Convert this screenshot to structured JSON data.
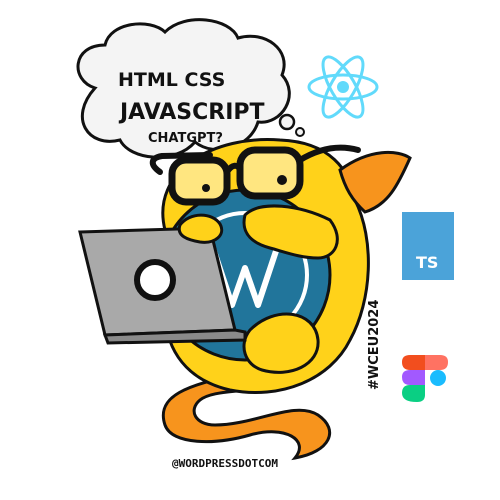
{
  "bubble": {
    "line1": "HTML CSS",
    "line2": "JAVASCRIPT",
    "line3": "CHATGPT?"
  },
  "badges": {
    "ts_label": "TS",
    "event_tag": "#WCEU2024"
  },
  "credit": "@WORDPRESSDOTCOM",
  "colors": {
    "wapuu_yellow": "#FFD21A",
    "tail_orange": "#F7941D",
    "wp_blue": "#21759B",
    "laptop_gray": "#A9A9A9",
    "react_cyan": "#61DAFB",
    "ts_blue": "#3178C6"
  }
}
